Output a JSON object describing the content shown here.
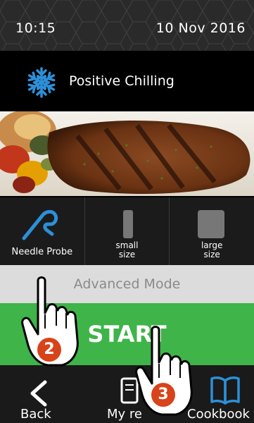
{
  "status": {
    "time": "10:15",
    "date": "10 Nov  2016"
  },
  "mode": {
    "label": "Positive Chilling",
    "icon": "snowflake-icon",
    "icon_color": "#2d8fd8"
  },
  "options": [
    {
      "label": "Needle Probe",
      "icon": "needle-probe-icon"
    },
    {
      "label_line1": "small",
      "label_line2": "size",
      "icon": "small-size-icon"
    },
    {
      "label_line1": "large",
      "label_line2": "size",
      "icon": "large-size-icon"
    }
  ],
  "advanced_label": "Advanced Mode",
  "start_label": "START",
  "start_color": "#3fb449",
  "nav": {
    "back_label": "Back",
    "recipes_label": "My re",
    "cookbook_label": "Cookbook"
  },
  "steps": [
    "2",
    "3"
  ],
  "step_badge_color": "#d8431a"
}
